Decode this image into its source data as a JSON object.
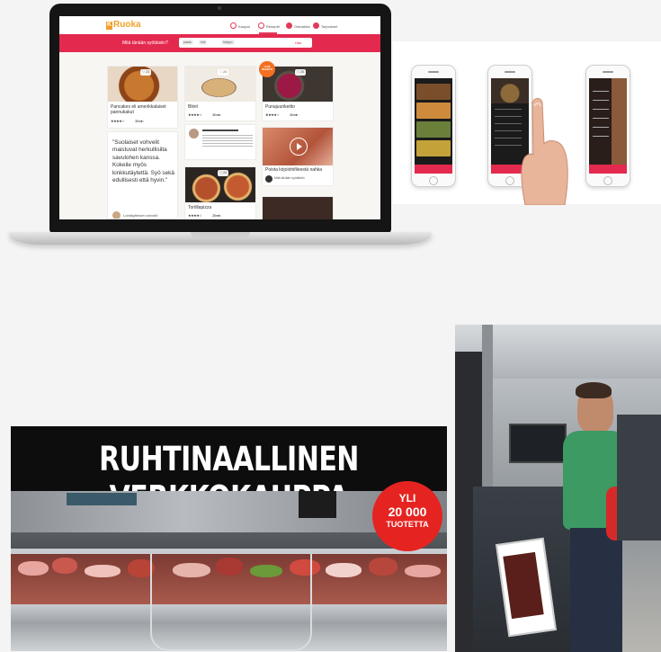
{
  "laptop_site": {
    "logo_mark": "K",
    "logo_text": "Ruoka",
    "nav": [
      "Kaupat",
      "Reseptit",
      "Ostoslista",
      "Tarjoukset"
    ],
    "search_label": "Mitä tänään syötäisiin?",
    "search_chips": [
      "pasta",
      "lohi",
      "helppo"
    ],
    "search_button": "Hae",
    "recipes": [
      {
        "title": "Pancakes eli amerikkalaiset pannukakut",
        "rating": "★★★★☆",
        "likes": "23",
        "time": "30 min"
      },
      {
        "title": "Blinit",
        "rating": "★★★★☆",
        "likes": "24",
        "time": "30 min"
      },
      {
        "title": "Punajuurikeitto",
        "rating": "★★★★☆",
        "likes": "25",
        "time": "40 min"
      },
      {
        "title": "Tortillapizza",
        "rating": "★★★★☆",
        "likes": "24",
        "time": "25 min"
      }
    ],
    "quote": "\"Suolaiset vohvelit maistuvat herkullisilta savulohen kanssa. Kokeile myös kinkkutäytettä. Syö sekä edullisesti että hyvin.\"",
    "quote_link": "Lohitäytteiset vohvelit",
    "video_title": "Poista kirjolohifileestä nahka",
    "video_author": "Mitä tänään syötäisiin",
    "orange_badge": "UUSI RESEPTI"
  },
  "store_banner": {
    "headline": "RUHTINAALLINEN VERKKOKAUPPA",
    "badge_top": "YLI",
    "badge_number": "20 000",
    "badge_bottom": "TUOTETTA"
  },
  "colors": {
    "brand_orange": "#f0a028",
    "brand_red": "#e4294e",
    "badge_red": "#e52421",
    "banner_black": "#0d0d0d"
  }
}
